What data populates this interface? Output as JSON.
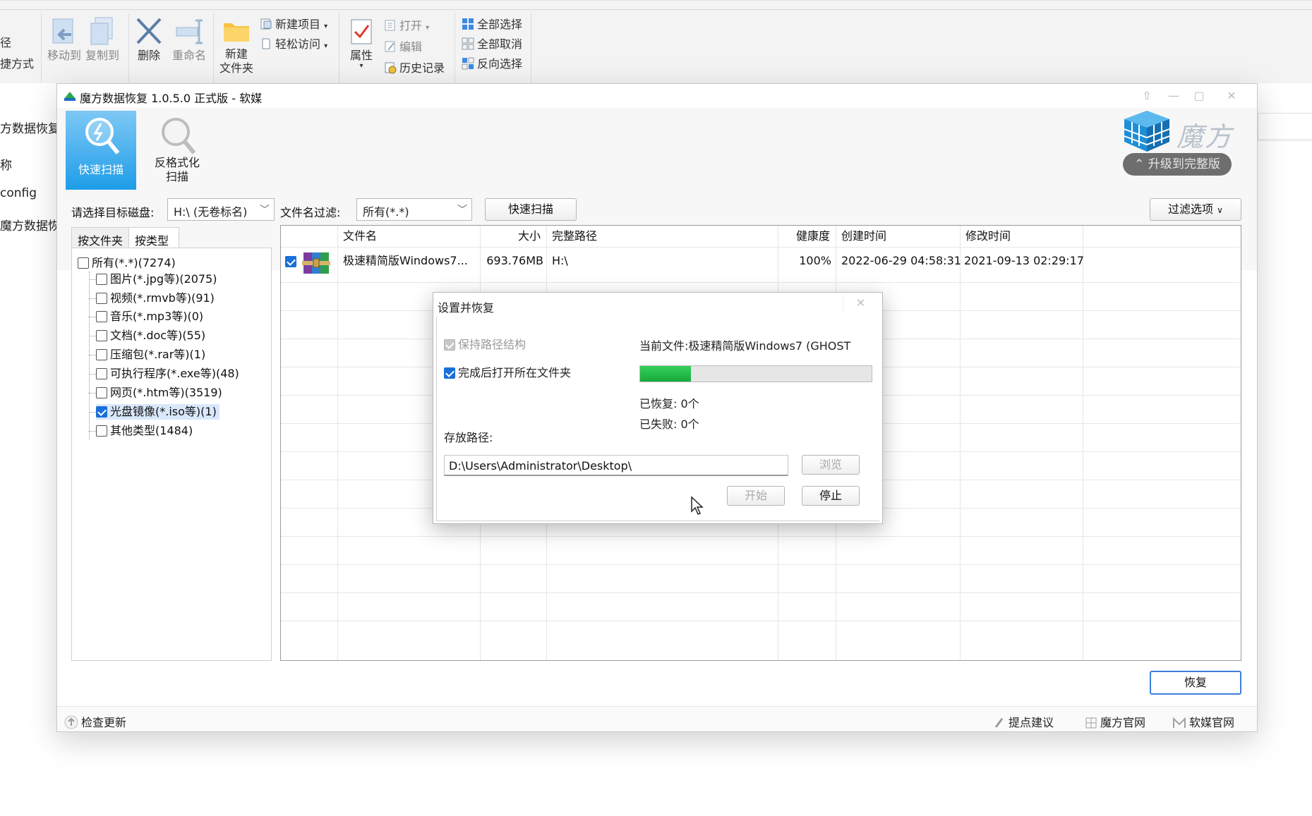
{
  "ribbon": {
    "left_partial_1": "径",
    "left_partial_2": "捷方式",
    "move_to": "移动到",
    "copy_to": "复制到",
    "delete": "删除",
    "rename": "重命名",
    "new_folder_line1": "新建",
    "new_folder_line2": "文件夹",
    "new_item": "新建项目",
    "easy_access": "轻松访问",
    "properties": "属性",
    "open": "打开",
    "edit": "编辑",
    "history": "历史记录",
    "select_all": "全部选择",
    "select_none": "全部取消",
    "invert_selection": "反向选择"
  },
  "explorer_left": {
    "item1": "方数据恢复",
    "item2": "称",
    "item3": "config",
    "item4": "魔方数据恢复"
  },
  "app": {
    "title": "魔方数据恢复 1.0.5.0 正式版 - 软媒",
    "quick_scan_tool": "快速扫描",
    "unformat_scan_line1": "反格式化",
    "unformat_scan_line2": "扫描",
    "logo_text": "魔方",
    "upgrade": "升级到完整版",
    "target_disk_label": "请选择目标磁盘:",
    "target_disk_value": "H:\\  (无卷标名)",
    "filename_filter_label": "文件名过滤:",
    "filename_filter_value": "所有(*.*)",
    "quick_scan_button": "快速扫描",
    "filter_options": "过滤选项",
    "recover_button": "恢复"
  },
  "tree": {
    "tab_folder": "按文件夹",
    "tab_type": "按类型",
    "items": [
      {
        "label": "所有(*.*)(7274)",
        "checked": false
      },
      {
        "label": "图片(*.jpg等)(2075)",
        "checked": false
      },
      {
        "label": "视频(*.rmvb等)(91)",
        "checked": false
      },
      {
        "label": "音乐(*.mp3等)(0)",
        "checked": false
      },
      {
        "label": "文档(*.doc等)(55)",
        "checked": false
      },
      {
        "label": "压缩包(*.rar等)(1)",
        "checked": false
      },
      {
        "label": "可执行程序(*.exe等)(48)",
        "checked": false
      },
      {
        "label": "网页(*.htm等)(3519)",
        "checked": false
      },
      {
        "label": "光盘镜像(*.iso等)(1)",
        "checked": true
      },
      {
        "label": "其他类型(1484)",
        "checked": false
      }
    ]
  },
  "table": {
    "columns": [
      "文件名",
      "大小",
      "完整路径",
      "健康度",
      "创建时间",
      "修改时间"
    ],
    "rows": [
      {
        "name": "极速精简版Windows7...",
        "size": "693.76MB",
        "path": "H:\\",
        "health": "100%",
        "created": "2022-06-29 04:58:31",
        "modified": "2021-09-13 02:29:17",
        "checked": true
      }
    ]
  },
  "dialog": {
    "title": "设置并恢复",
    "keep_path_structure": "保持路径结构",
    "open_folder_after": "完成后打开所在文件夹",
    "current_file_label": "当前文件:",
    "current_file_value": "极速精简版Windows7 (GHOST",
    "progress": 0.22,
    "recovered": "已恢复: 0个",
    "failed": "已失败: 0个",
    "save_path_label": "存放路径:",
    "save_path_value": "D:\\Users\\Administrator\\Desktop\\",
    "browse": "浏览",
    "start": "开始",
    "stop": "停止",
    "close_glyph": "✕"
  },
  "statusbar": {
    "check_update": "检查更新",
    "feedback": "提点建议",
    "mofang_site": "魔方官网",
    "ruanmei_site": "软媒官网"
  },
  "colors": {
    "accent_blue": "#1e9de8",
    "progress_green": "#18a93a",
    "checkbox_blue": "#1a6fd8"
  }
}
